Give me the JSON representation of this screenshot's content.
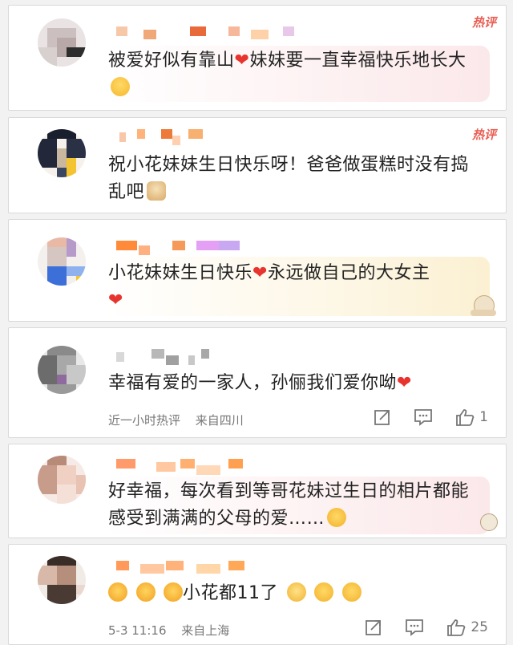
{
  "comments": [
    {
      "hot": "热评",
      "text_a": "被爱好似有靠山",
      "text_b": "妹妹要一直幸福快乐地长大",
      "colors": [
        "#f7c8a8",
        "#f0a878",
        "#e86a3a",
        "#f6b79a",
        "#ffd1a8",
        "#f8d2b8",
        "#e8c8e8"
      ]
    },
    {
      "hot": "热评",
      "text_a": "祝小花妹妹生日快乐呀！爸爸做蛋糕时没有捣乱吧",
      "colors": [
        "#f8c7a8",
        "#ffb27a",
        "#ee7a3a",
        "#ffd0b0",
        "#f7b070"
      ]
    },
    {
      "text_a": "小花妹妹生日快乐",
      "text_b": "永远做自己的大女主",
      "colors": [
        "#ff8a3a",
        "#ffb080",
        "#f59a5a",
        "#e3a0f5",
        "#c8a8f0"
      ]
    },
    {
      "text_a": "幸福有爱的一家人，孙俪我们爱你呦",
      "meta_time": "近一小时热评",
      "meta_loc": "来自四川",
      "like_count": "1",
      "colors": [
        "#d8d8d8",
        "#b8b8b8",
        "#a0a0a0",
        "#c8c8c8"
      ]
    },
    {
      "text_a": "好幸福，每次看到等哥花妹过生日的相片都能感受到满满的父母的爱……",
      "colors": [
        "#ff9a6a",
        "#ffc8a0",
        "#ffb070",
        "#ffd8b8",
        "#ffa050"
      ]
    },
    {
      "text_b": "小花都11了",
      "meta_time": "5-3 11:16",
      "meta_loc": "来自上海",
      "like_count": "25",
      "colors": [
        "#ff9a5a",
        "#ffc8a0",
        "#ffb27a",
        "#ffd6a8",
        "#ffa858"
      ]
    }
  ],
  "icons": {
    "heart": "heart-icon",
    "share": "share-icon",
    "comment": "comment-icon",
    "like": "like-icon"
  },
  "accent": "#e95d53",
  "heart_color": "#e8342f"
}
